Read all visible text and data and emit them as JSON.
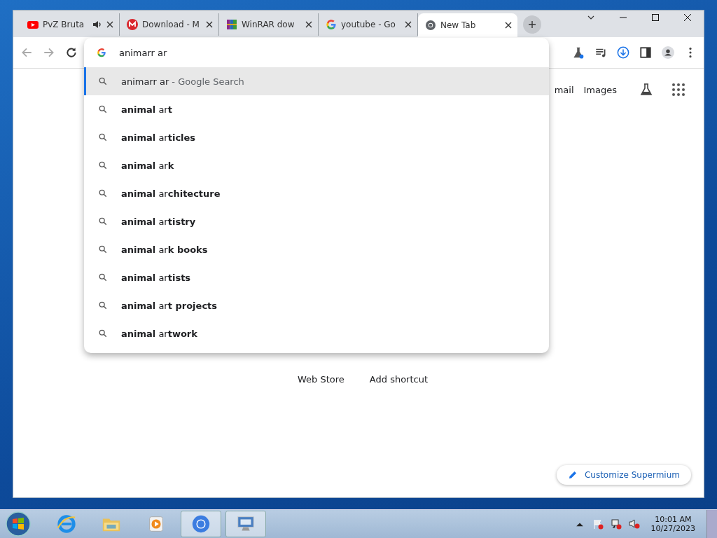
{
  "tabs": [
    {
      "title": "PvZ Bruta",
      "kind": "youtube",
      "audio": true,
      "selected": false
    },
    {
      "title": "Download - M",
      "kind": "mega",
      "audio": false,
      "selected": false
    },
    {
      "title": "WinRAR dow",
      "kind": "winrar",
      "audio": false,
      "selected": false
    },
    {
      "title": "youtube - Go",
      "kind": "google",
      "audio": false,
      "selected": false
    },
    {
      "title": "New Tab",
      "kind": "chromium",
      "audio": false,
      "selected": true
    }
  ],
  "omnibox": {
    "value": "animarr ar"
  },
  "suggestions": [
    {
      "text": "animarr ar",
      "hint": "- Google Search",
      "selected": true
    },
    {
      "text": "**animal** ar**t**",
      "selected": false
    },
    {
      "text": "**animal** ar**ticles**",
      "selected": false
    },
    {
      "text": "**animal** ar**k**",
      "selected": false
    },
    {
      "text": "**animal** ar**chitecture**",
      "selected": false
    },
    {
      "text": "**animal** ar**tistry**",
      "selected": false
    },
    {
      "text": "**animal** ar**k books**",
      "selected": false
    },
    {
      "text": "**animal** ar**tists**",
      "selected": false
    },
    {
      "text": "**animal** ar**t projects**",
      "selected": false
    },
    {
      "text": "**animal** ar**twork**",
      "selected": false
    }
  ],
  "page": {
    "top_links": [
      "mail",
      "Images"
    ],
    "shortcuts": [
      "Web Store",
      "Add shortcut"
    ],
    "customize": "Customize Supermium"
  },
  "taskbar": {
    "time": "10:01 AM",
    "date": "10/27/2023",
    "apps": [
      {
        "kind": "ie",
        "selected": false
      },
      {
        "kind": "folder",
        "selected": false
      },
      {
        "kind": "media",
        "selected": false
      },
      {
        "kind": "chromium",
        "selected": true
      },
      {
        "kind": "remote",
        "selected": true
      }
    ]
  }
}
